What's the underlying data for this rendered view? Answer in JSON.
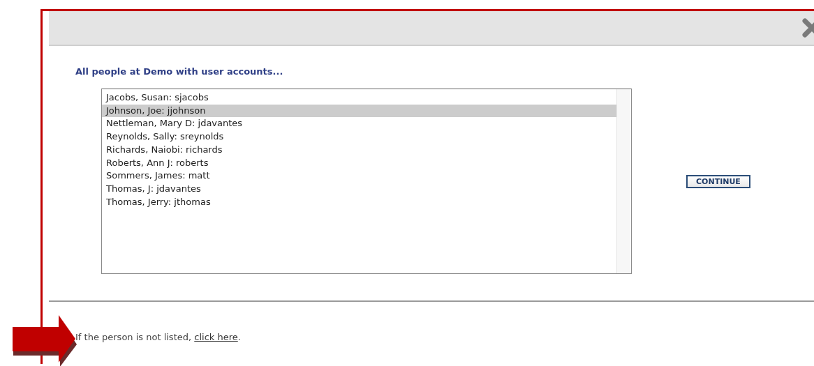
{
  "dialog": {
    "heading": "All people at Demo with user accounts...",
    "people": [
      {
        "label": "Jacobs, Susan: sjacobs",
        "selected": false
      },
      {
        "label": "Johnson, Joe: jjohnson",
        "selected": true
      },
      {
        "label": "Nettleman, Mary D: jdavantes",
        "selected": false
      },
      {
        "label": "Reynolds, Sally: sreynolds",
        "selected": false
      },
      {
        "label": "Richards, Naiobi: richards",
        "selected": false
      },
      {
        "label": "Roberts, Ann J: roberts",
        "selected": false
      },
      {
        "label": "Sommers, James: matt",
        "selected": false
      },
      {
        "label": "Thomas, J: jdavantes",
        "selected": false
      },
      {
        "label": "Thomas, Jerry: jthomas",
        "selected": false
      }
    ],
    "continue_button": "CONTINUE",
    "footer": {
      "text_before": "If the person is not listed, ",
      "link": "click here",
      "text_after": "."
    }
  }
}
